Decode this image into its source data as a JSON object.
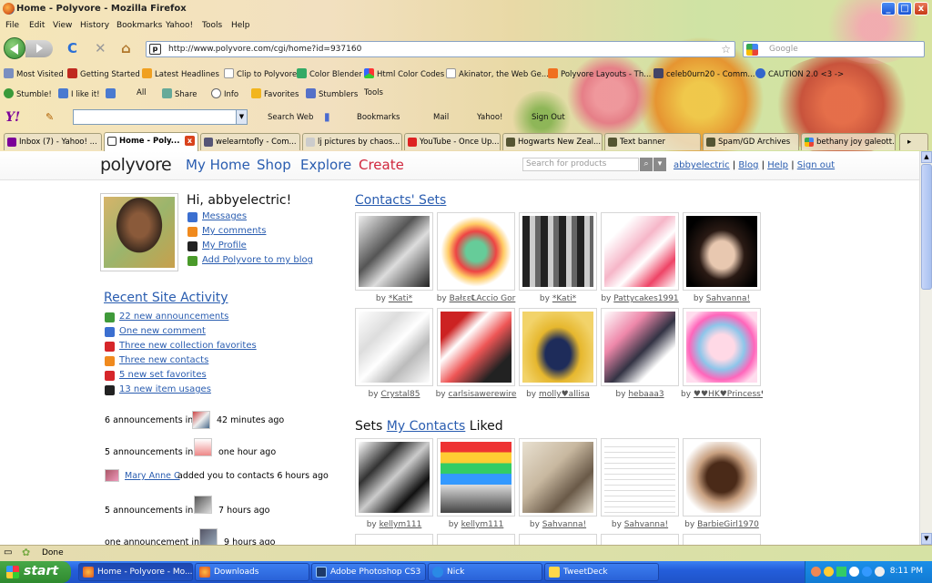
{
  "window": {
    "title": "Home - Polyvore - Mozilla Firefox",
    "btn_min": "_",
    "btn_max": "□",
    "btn_close": "x"
  },
  "menu": [
    "File",
    "Edit",
    "View",
    "History",
    "Bookmarks",
    "Yahoo!",
    "Tools",
    "Help"
  ],
  "nav": {
    "url": "http://www.polyvore.com/cgi/home?id=937160",
    "search_placeholder": "Google",
    "site_glyph": "p",
    "reload_glyph": "C",
    "stop_glyph": "✕",
    "home_glyph": "⌂",
    "star_glyph": "☆"
  },
  "bookmarks": [
    "Most Visited",
    "Getting Started",
    "Latest Headlines",
    "Clip to Polyvore",
    "Color Blender",
    "Html Color Codes",
    "Akinator, the Web Ge...",
    "Polyvore Layouts - Th...",
    "celeb0urn20 - Comm...",
    "CAUTION 2.0 <3 ->"
  ],
  "toolbar2": [
    "Stumble!",
    "I like it!",
    "All",
    "Share",
    "Info",
    "Favorites",
    "Stumblers",
    "Tools"
  ],
  "yahoo": {
    "logo": "Y!",
    "items": [
      "Search Web",
      "Bookmarks",
      "Mail",
      "Yahoo!",
      "Sign Out"
    ]
  },
  "tabs": [
    "Inbox (7) - Yahoo! ...",
    "Home - Poly...",
    "welearntofly - Com...",
    "lj pictures by chaos...",
    "YouTube - Once Up...",
    "Hogwarts New Zeal...",
    "Text banner",
    "Spam/GD Archives",
    "bethany joy galeott..."
  ],
  "polyvore": {
    "logo": "polyvore",
    "nav": [
      "My Home",
      "Shop",
      "Explore",
      "Create"
    ],
    "search_placeholder": "Search for products",
    "user_links": [
      "abbyelectric",
      "Blog",
      "Help",
      "Sign out"
    ],
    "greeting": "Hi, abbyelectric!",
    "account_links": [
      "Messages",
      "My comments",
      "My Profile",
      "Add Polyvore to my blog"
    ],
    "recent_title": "Recent Site Activity",
    "activity": [
      "22 new announcements",
      "One new comment",
      "Three new collection favorites",
      "Three new contacts",
      "5 new set favorites",
      "13 new item usages"
    ],
    "feed": [
      {
        "text": "6 announcements in",
        "time": "42 minutes ago"
      },
      {
        "text": "5 announcements in",
        "time": "one hour ago"
      },
      {
        "name": "Mary Anne C",
        "text": "added you to contacts 6 hours ago"
      },
      {
        "text": "5 announcements in",
        "time": "7 hours ago"
      },
      {
        "text": "one announcement in",
        "time": "9 hours ago"
      }
    ],
    "contacts_sets_title": "Contacts' Sets",
    "contacts_sets": [
      {
        "by": "by",
        "author": "*Kati*"
      },
      {
        "by": "by",
        "author": "Bałεε℄Accio Gor"
      },
      {
        "by": "by",
        "author": "*Kati*"
      },
      {
        "by": "by",
        "author": "Pattycakes1991"
      },
      {
        "by": "by",
        "author": "Sahvanna!"
      },
      {
        "by": "by",
        "author": "Crystal85"
      },
      {
        "by": "by",
        "author": "carlsisawerewire"
      },
      {
        "by": "by",
        "author": "molly♥allisa"
      },
      {
        "by": "by",
        "author": "hebaaa3"
      },
      {
        "by": "by",
        "author": "♥♥HK♥Princess♥"
      }
    ],
    "liked_prefix": "Sets",
    "liked_link": "My Contacts",
    "liked_suffix": "Liked",
    "liked_sets": [
      {
        "by": "by",
        "author": "kellym111"
      },
      {
        "by": "by",
        "author": "kellym111"
      },
      {
        "by": "by",
        "author": "Sahvanna!"
      },
      {
        "by": "by",
        "author": "Sahvanna!"
      },
      {
        "by": "by",
        "author": "BarbieGirl1970"
      }
    ]
  },
  "status": "Done",
  "taskbar": {
    "start": "start",
    "tasks": [
      "Home - Polyvore - Mo...",
      "Downloads",
      "Adobe Photoshop CS3",
      "Nick",
      "TweetDeck"
    ],
    "clock": "8:11 PM"
  }
}
